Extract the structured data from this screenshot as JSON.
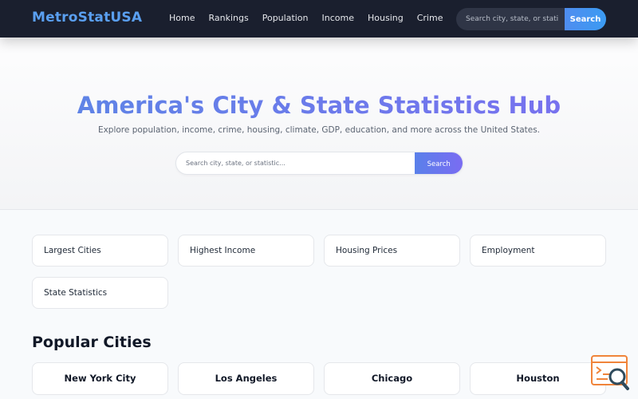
{
  "header": {
    "logo": "MetroStatUSA",
    "nav": [
      "Home",
      "Rankings",
      "Population",
      "Income",
      "Housing",
      "Crime"
    ],
    "search_placeholder": "Search city, state, or stati",
    "search_button": "Search"
  },
  "hero": {
    "title": "America's City & State Statistics Hub",
    "subtitle": "Explore population, income, crime, housing, climate, GDP, education, and more across the United States.",
    "search_placeholder": "Search city, state, or statistic...",
    "search_button": "Search"
  },
  "quick_links": [
    "Largest Cities",
    "Highest Income",
    "Housing Prices",
    "Employment",
    "State Statistics"
  ],
  "popular": {
    "title": "Popular Cities",
    "cities": [
      "New York City",
      "Los Angeles",
      "Chicago",
      "Houston"
    ]
  },
  "colors": {
    "header_bg": "#1a1f2e",
    "logo": "#5a9ff0",
    "accent_start": "#5b86e5",
    "accent_end": "#7b6ff0"
  },
  "icons": {
    "widget": "code-search-icon"
  }
}
